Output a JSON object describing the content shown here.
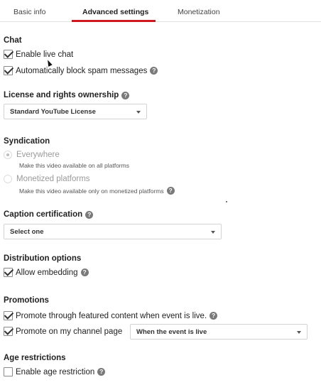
{
  "tabs": {
    "basic_info": "Basic info",
    "advanced_settings": "Advanced settings",
    "monetization": "Monetization"
  },
  "chat": {
    "title": "Chat",
    "enable_live_chat": {
      "label": "Enable live chat",
      "checked": true
    },
    "block_spam": {
      "label": "Automatically block spam messages",
      "checked": true
    }
  },
  "license": {
    "title": "License and rights ownership",
    "selected": "Standard YouTube License"
  },
  "syndication": {
    "title": "Syndication",
    "everywhere": {
      "label": "Everywhere",
      "desc": "Make this video available on all platforms",
      "selected": true
    },
    "monetized": {
      "label": "Monetized platforms",
      "desc": "Make this video available only on monetized platforms",
      "selected": false
    }
  },
  "caption": {
    "title": "Caption certification",
    "selected": "Select one"
  },
  "distribution": {
    "title": "Distribution options",
    "allow_embedding": {
      "label": "Allow embedding",
      "checked": true
    }
  },
  "promotions": {
    "title": "Promotions",
    "featured": {
      "label": "Promote through featured content when event is live.",
      "checked": true
    },
    "channel_page": {
      "label": "Promote on my channel page",
      "checked": true,
      "selected": "When the event is live"
    }
  },
  "age": {
    "title": "Age restrictions",
    "enable": {
      "label": "Enable age restriction",
      "checked": false
    }
  },
  "help_glyph": "?",
  "colors": {
    "accent": "#cc181e",
    "help_icon": "#7a7a7a"
  }
}
